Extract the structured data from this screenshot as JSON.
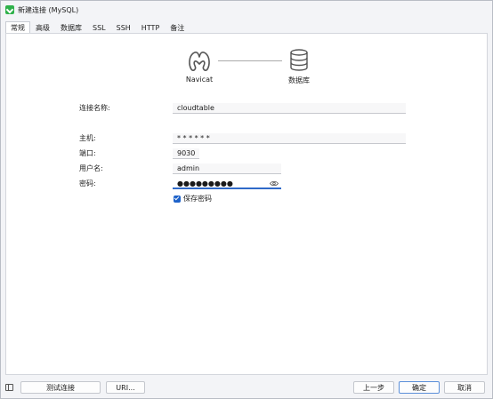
{
  "window": {
    "title": "新建连接 (MySQL)"
  },
  "tabs": [
    {
      "label": "常规",
      "active": true
    },
    {
      "label": "高级",
      "active": false
    },
    {
      "label": "数据库",
      "active": false
    },
    {
      "label": "SSL",
      "active": false
    },
    {
      "label": "SSH",
      "active": false
    },
    {
      "label": "HTTP",
      "active": false
    },
    {
      "label": "备注",
      "active": false
    }
  ],
  "header": {
    "client_label": "Navicat",
    "server_label": "数据库"
  },
  "form": {
    "connection_name": {
      "label": "连接名称:",
      "value": "cloudtable"
    },
    "host": {
      "label": "主机:",
      "value": "* * * * * *"
    },
    "port": {
      "label": "端口:",
      "value": "9030"
    },
    "username": {
      "label": "用户名:",
      "value": "admin"
    },
    "password": {
      "label": "密码:",
      "value": "●●●●●●●●●"
    },
    "save_password": {
      "label": "保存密码",
      "checked": true
    }
  },
  "footer": {
    "test_button": "测试连接",
    "uri_button": "URI...",
    "prev_button": "上一步",
    "ok_button": "确定",
    "cancel_button": "取消"
  },
  "icons": {
    "app": "navicat-app-icon",
    "client": "navicat-logo-icon",
    "server": "database-icon",
    "eye": "eye-icon",
    "panel": "sidebar-toggle-icon"
  },
  "colors": {
    "accent": "#1e62c9",
    "app_icon": "#2fb14b"
  }
}
